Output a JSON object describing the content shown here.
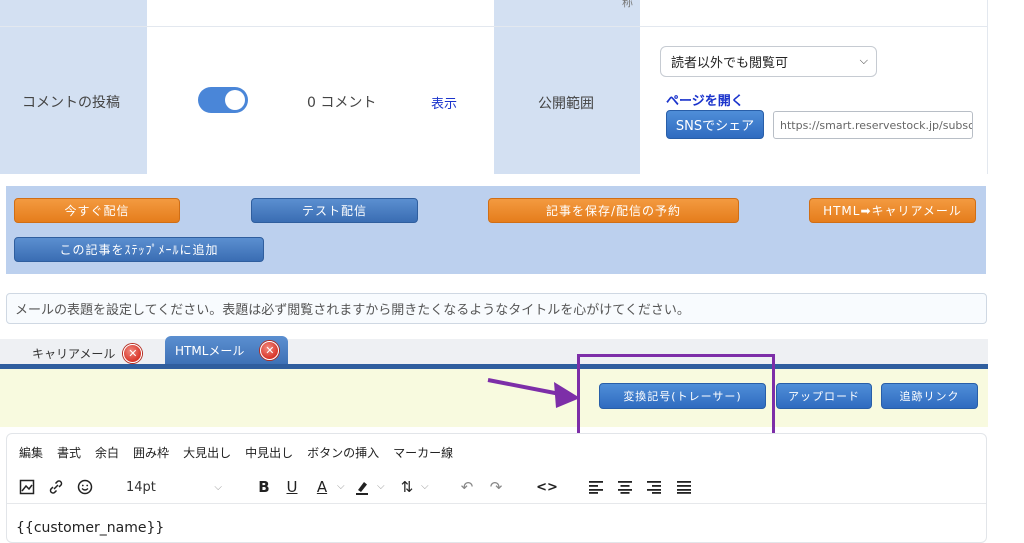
{
  "settings": {
    "cut_label": "称",
    "comment": {
      "label": "コメントの投稿",
      "toggle_on": true,
      "count_text": "0 コメント",
      "show_link": "表示"
    },
    "visibility": {
      "label": "公開範囲",
      "select_value": "読者以外でも閲覧可",
      "open_page_link": "ページを開く",
      "share_button": "SNSでシェア",
      "url_value": "https://smart.reservestock.jp/subsc"
    }
  },
  "actions": {
    "send_now": "今すぐ配信",
    "test_send": "テスト配信",
    "save_schedule": "記事を保存/配信の予約",
    "html_to_carrier": "HTML➡キャリアメール",
    "add_to_step": "この記事をｽﾃｯﾌﾟﾒｰﾙに追加"
  },
  "hint_text": "メールの表題を設定してください。表題は必ず閲覧されますから開きたくなるようなタイトルを心がけてください。",
  "tabs": [
    {
      "label": "キャリアメール",
      "active": false
    },
    {
      "label": "HTMLメール",
      "active": true
    }
  ],
  "tool_buttons": {
    "convert": "変換記号(トレーサー)",
    "upload": "アップロード",
    "tracking": "追跡リンク"
  },
  "editor": {
    "menu": [
      "編集",
      "書式",
      "余白",
      "囲み枠",
      "大見出し",
      "中見出し",
      "ボタンの挿入",
      "マーカー線"
    ],
    "font_size": "14pt",
    "content_preview": "{{customer_name}}"
  },
  "colors": {
    "annotation": "#7d2ea8",
    "accent_blue": "#2f6bc0",
    "accent_orange": "#e57d1c"
  }
}
